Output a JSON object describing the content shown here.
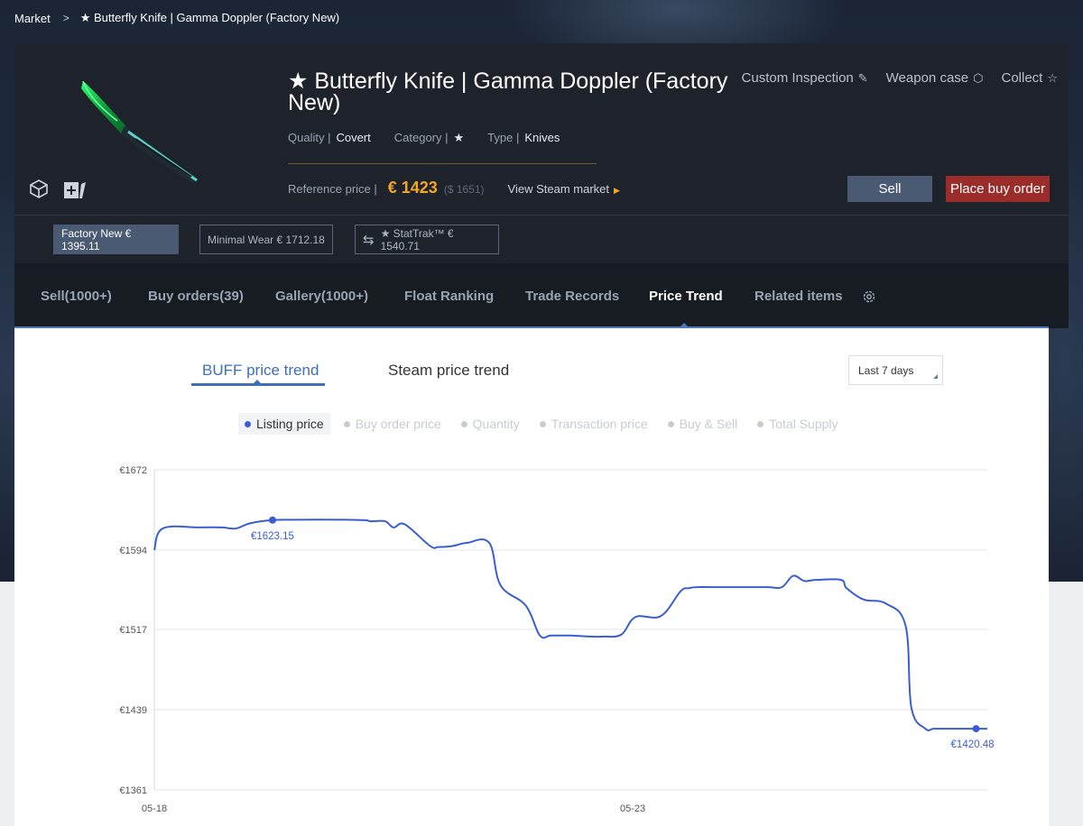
{
  "breadcrumb": {
    "root": "Market",
    "current": "★ Butterfly Knife | Gamma Doppler (Factory New)"
  },
  "item": {
    "title": "★ Butterfly Knife | Gamma Doppler (Factory New)",
    "quality_label": "Quality |",
    "quality": "Covert",
    "category_label": "Category |",
    "category": "★",
    "type_label": "Type |",
    "type": "Knives",
    "ref_price_label": "Reference price |",
    "ref_price": "€ 1423",
    "ref_price_usd": "($ 1651)",
    "steam_link": "View Steam market",
    "price_color": "#f5a623"
  },
  "top_links": {
    "custom_inspection": "Custom Inspection",
    "weapon_case": "Weapon case",
    "collect": "Collect"
  },
  "actions": {
    "sell": "Sell",
    "buy_order": "Place buy order"
  },
  "wear_options": {
    "factory_new": "Factory New € 1395.11",
    "minimal_wear": "Minimal Wear € 1712.18",
    "stattrak": "★ StatTrak™ € 1540.71"
  },
  "tabs": [
    {
      "label": "Sell(1000+)"
    },
    {
      "label": "Buy orders(39)"
    },
    {
      "label": "Gallery(1000+)"
    },
    {
      "label": "Float Ranking"
    },
    {
      "label": "Trade Records"
    },
    {
      "label": "Price Trend"
    },
    {
      "label": "Related items"
    }
  ],
  "sub_tabs": {
    "buff": "BUFF price trend",
    "steam": "Steam price trend"
  },
  "range": "Last 7 days",
  "legend": [
    {
      "label": "Listing price",
      "active": true
    },
    {
      "label": "Buy order price",
      "active": false
    },
    {
      "label": "Quantity",
      "active": false
    },
    {
      "label": "Transaction price",
      "active": false
    },
    {
      "label": "Buy & Sell",
      "active": false
    },
    {
      "label": "Total Supply",
      "active": false
    }
  ],
  "chart_data": {
    "type": "line",
    "series": [
      {
        "name": "Listing price",
        "color": "#3b5dd4",
        "x": [
          0,
          0.15,
          0.8,
          1.2,
          1.45,
          1.7,
          2.1,
          2.55,
          3.4,
          3.75,
          3.85,
          4.1,
          4.25,
          4.45,
          4.9,
          5.05,
          5.3,
          5.55,
          5.95,
          6.15,
          6.6,
          6.85,
          7.05,
          7.4,
          7.75,
          8.0,
          8.3,
          8.55,
          9.0,
          9.35,
          9.5,
          9.65,
          10.05,
          10.3,
          10.45,
          10.9,
          11.15,
          11.35,
          11.55,
          11.75,
          12.2,
          12.3,
          12.6,
          13.0,
          13.35,
          13.45,
          13.7,
          13.85,
          14.1,
          14.45,
          14.6,
          14.8
        ],
        "y": [
          1594,
          1615,
          1616,
          1616,
          1615,
          1620,
          1623.15,
          1623.5,
          1623.5,
          1623,
          1622,
          1622,
          1616,
          1619,
          1598,
          1597,
          1598,
          1601,
          1601,
          1560,
          1540,
          1511,
          1511,
          1511,
          1510,
          1510,
          1512,
          1529,
          1530,
          1554,
          1557,
          1558,
          1558,
          1558,
          1558,
          1558,
          1558,
          1569,
          1564,
          1565,
          1565,
          1557,
          1546,
          1542,
          1520,
          1441,
          1420.48,
          1420.48,
          1420.48,
          1420.48,
          1420.48,
          1420.48
        ]
      }
    ],
    "xticks": [
      "05-18",
      "05-23"
    ],
    "yticks": [
      1361,
      1439,
      1517,
      1594,
      1672
    ],
    "ytick_labels": [
      "€1361",
      "€1439",
      "€1517",
      "€1594",
      "€1672"
    ],
    "ylim": [
      1361,
      1672
    ],
    "grid": true,
    "annotations": [
      {
        "x": 2.1,
        "y": 1623.15,
        "label": "€1623.15"
      },
      {
        "x": 14.6,
        "y": 1420.48,
        "label": "€1420.48"
      }
    ]
  }
}
